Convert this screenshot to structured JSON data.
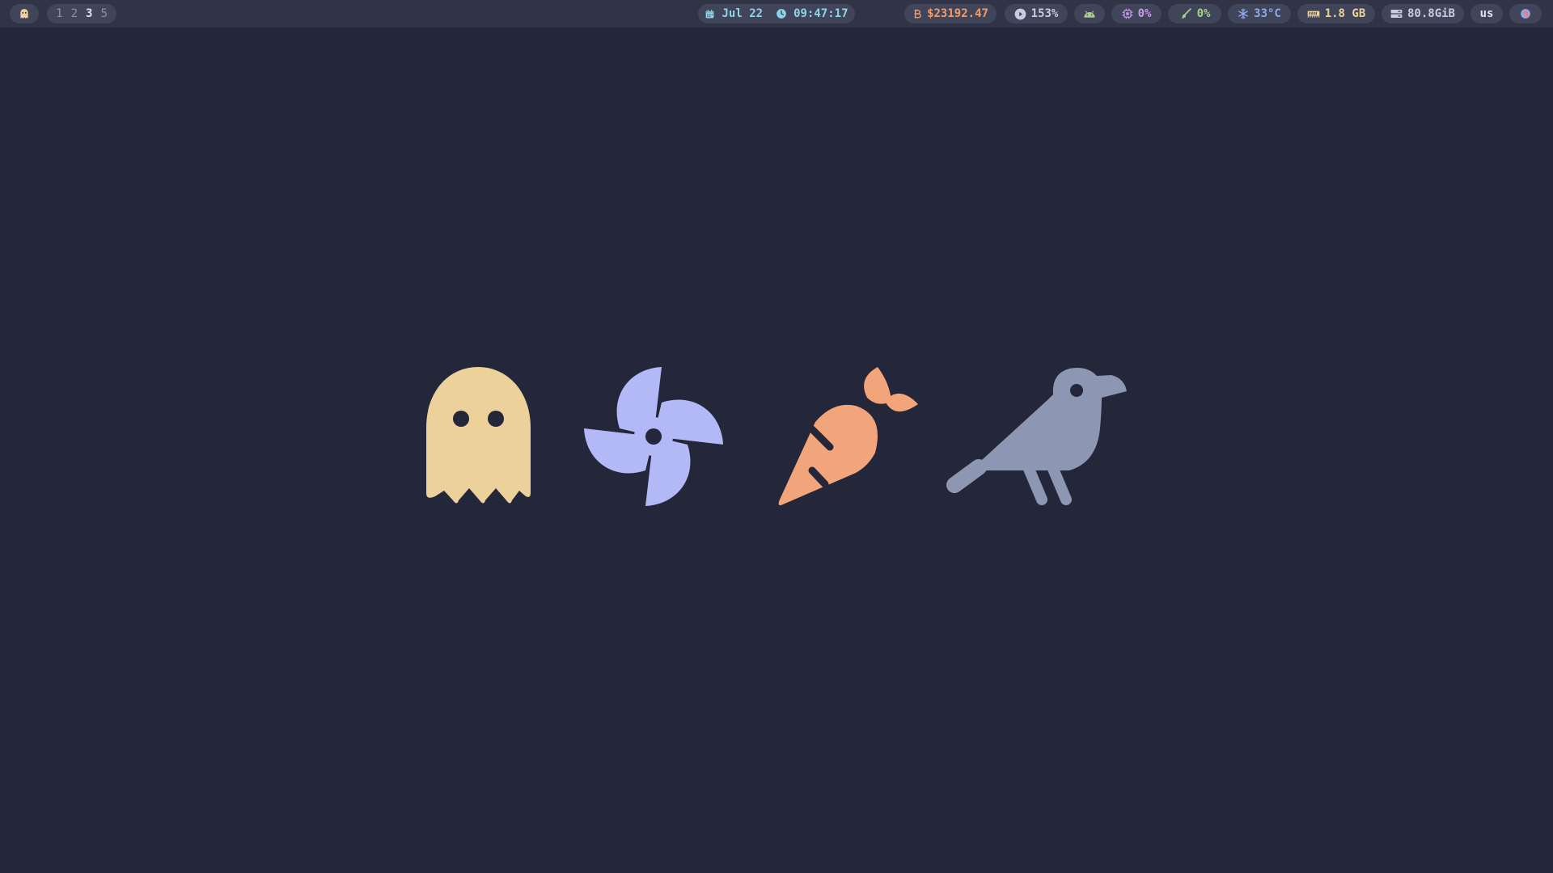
{
  "workspaces": {
    "items": [
      "1",
      "2",
      "3",
      "5"
    ],
    "active": "3"
  },
  "clock": {
    "date": "Jul 22",
    "time": "09:47:17"
  },
  "modules": {
    "bitcoin": "$23192.47",
    "volume": "153%",
    "cpu": "0%",
    "gpu": "0%",
    "temperature": "33°C",
    "memory": "1.8 GB",
    "disk": "80.8GiB",
    "keyboard_layout": "us"
  },
  "icons": {
    "launcher": "ghost-icon",
    "date": "calendar-icon",
    "time": "clock-icon",
    "bitcoin": "bitcoin-icon",
    "volume": "play-icon",
    "status": "android-icon",
    "cpu": "cpu-chip-icon",
    "gpu": "brush-icon",
    "temperature": "snowflake-icon",
    "memory": "ram-icon",
    "disk": "drive-icon",
    "power": "power-menu-icon"
  },
  "colors": {
    "background": "#242739",
    "bar": "#303446",
    "pill": "#414559",
    "ghost": "#ecd19b",
    "pinwheel": "#b3b8f6",
    "carrot": "#f2a57b",
    "crow": "#8d96b3",
    "accent_teal": "#8fd3e8",
    "accent_orange": "#f29b6b",
    "accent_mauve": "#c59be8",
    "accent_green": "#a6d189",
    "accent_blue": "#8caaee",
    "accent_yellow": "#ecd19b"
  }
}
